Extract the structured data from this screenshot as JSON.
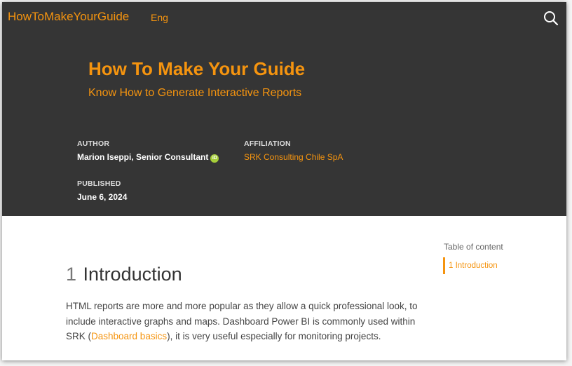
{
  "navbar": {
    "brand": "HowToMakeYourGuide",
    "language": "Eng",
    "search_icon": "search-icon"
  },
  "header": {
    "title": "How To Make Your Guide",
    "subtitle": "Know How to Generate Interactive Reports",
    "author_label": "AUTHOR",
    "author_name": "Marion Iseppi, Senior Consultant",
    "orcid_icon": "orcid-icon",
    "orcid_text": "iD",
    "affiliation_label": "AFFILIATION",
    "affiliation": "SRK Consulting Chile SpA",
    "published_label": "PUBLISHED",
    "published_date": "June 6, 2024"
  },
  "toc": {
    "heading": "Table of content",
    "items": [
      {
        "label": "1 Introduction"
      }
    ]
  },
  "content": {
    "section_number": "1",
    "section_title": "Introduction",
    "paragraph_before": "HTML reports are more and more popular as they allow a quick professional look, to include interactive graphs and maps. Dashboard Power BI is commonly used within SRK (",
    "paragraph_link": "Dashboard basics",
    "paragraph_after": "), it is very useful especially for monitoring projects."
  },
  "colors": {
    "accent": "#f5940f",
    "header_background": "#353535",
    "page_background": "#ffffff"
  }
}
